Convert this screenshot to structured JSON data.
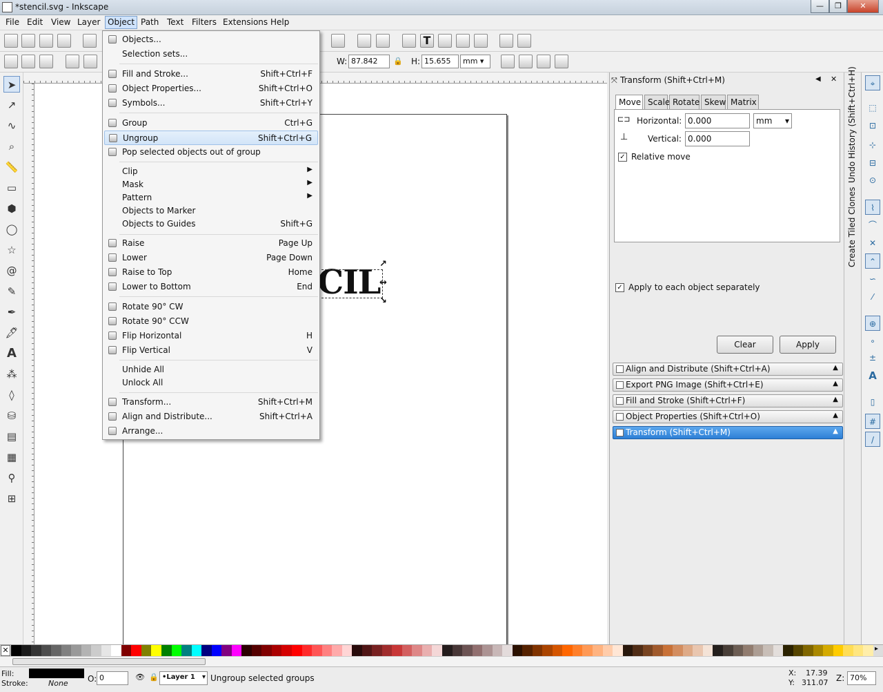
{
  "window": {
    "title": "*stencil.svg - Inkscape"
  },
  "menubar": [
    "File",
    "Edit",
    "View",
    "Layer",
    "Object",
    "Path",
    "Text",
    "Filters",
    "Extensions",
    "Help"
  ],
  "toolbar": {
    "w_label": "W:",
    "w_value": "87.842",
    "h_label": "H:",
    "h_value": "15.655",
    "unit": "mm"
  },
  "canvas": {
    "text": "CIL"
  },
  "object_menu": {
    "items": [
      {
        "label": "Objects...",
        "shortcut": ""
      },
      {
        "label": "Selection sets...",
        "shortcut": ""
      },
      {
        "label": "Fill and Stroke...",
        "shortcut": "Shift+Ctrl+F"
      },
      {
        "label": "Object Properties...",
        "shortcut": "Shift+Ctrl+O"
      },
      {
        "label": "Symbols...",
        "shortcut": "Shift+Ctrl+Y"
      },
      {
        "label": "Group",
        "shortcut": "Ctrl+G"
      },
      {
        "label": "Ungroup",
        "shortcut": "Shift+Ctrl+G"
      },
      {
        "label": "Pop selected objects out of group",
        "shortcut": ""
      },
      {
        "label": "Clip",
        "shortcut": ""
      },
      {
        "label": "Mask",
        "shortcut": ""
      },
      {
        "label": "Pattern",
        "shortcut": ""
      },
      {
        "label": "Objects to Marker",
        "shortcut": ""
      },
      {
        "label": "Objects to Guides",
        "shortcut": "Shift+G"
      },
      {
        "label": "Raise",
        "shortcut": "Page Up"
      },
      {
        "label": "Lower",
        "shortcut": "Page Down"
      },
      {
        "label": "Raise to Top",
        "shortcut": "Home"
      },
      {
        "label": "Lower to Bottom",
        "shortcut": "End"
      },
      {
        "label": "Rotate 90° CW",
        "shortcut": ""
      },
      {
        "label": "Rotate 90° CCW",
        "shortcut": ""
      },
      {
        "label": "Flip Horizontal",
        "shortcut": "H"
      },
      {
        "label": "Flip Vertical",
        "shortcut": "V"
      },
      {
        "label": "Unhide All",
        "shortcut": ""
      },
      {
        "label": "Unlock All",
        "shortcut": ""
      },
      {
        "label": "Transform...",
        "shortcut": "Shift+Ctrl+M"
      },
      {
        "label": "Align and Distribute...",
        "shortcut": "Shift+Ctrl+A"
      },
      {
        "label": "Arrange...",
        "shortcut": ""
      }
    ]
  },
  "transform": {
    "title": "Transform (Shift+Ctrl+M)",
    "tabs": [
      "Move",
      "Scale",
      "Rotate",
      "Skew",
      "Matrix"
    ],
    "horizontal_label": "Horizontal:",
    "horizontal_value": "0.000",
    "unit": "mm",
    "vertical_label": "Vertical:",
    "vertical_value": "0.000",
    "relative_move": "Relative move",
    "apply_each": "Apply to each object separately",
    "clear": "Clear",
    "apply": "Apply"
  },
  "dock": [
    "Align and Distribute (Shift+Ctrl+A)",
    "Export PNG Image (Shift+Ctrl+E)",
    "Fill and Stroke (Shift+Ctrl+F)",
    "Object Properties (Shift+Ctrl+O)",
    "Transform (Shift+Ctrl+M)"
  ],
  "vtabs": {
    "undo": "Undo History (Shift+Ctrl+H)",
    "tiled": "Create Tiled Clones"
  },
  "status": {
    "fill_label": "Fill:",
    "stroke_label": "Stroke:",
    "stroke_value": "None",
    "opacity_label": "O:",
    "opacity_value": "0",
    "layer": "•Layer 1",
    "message": "Ungroup selected groups",
    "x_label": "X:",
    "x_value": "17.39",
    "y_label": "Y:",
    "y_value": "311.07",
    "zoom_label": "Z:",
    "zoom_value": "70%"
  },
  "palette": [
    "#000000",
    "#1a1a1a",
    "#333333",
    "#4d4d4d",
    "#666666",
    "#808080",
    "#999999",
    "#b3b3b3",
    "#cccccc",
    "#e6e6e6",
    "#ffffff",
    "#800000",
    "#ff0000",
    "#808000",
    "#ffff00",
    "#008000",
    "#00ff00",
    "#008080",
    "#00ffff",
    "#000080",
    "#0000ff",
    "#800080",
    "#ff00ff",
    "#2b0000",
    "#550000",
    "#800000",
    "#aa0000",
    "#d40000",
    "#ff0000",
    "#ff2a2a",
    "#ff5555",
    "#ff8080",
    "#ffaaaa",
    "#ffd5d5",
    "#280b0b",
    "#501616",
    "#782121",
    "#a02c2c",
    "#c83737",
    "#d35f5f",
    "#de8787",
    "#e9afaf",
    "#f4d7d7",
    "#241c1c",
    "#483737",
    "#6c5353",
    "#916f6f",
    "#ac9393",
    "#c8b7b7",
    "#e3dbdb",
    "#2b1100",
    "#552200",
    "#803300",
    "#aa4400",
    "#d45500",
    "#ff6600",
    "#ff7f2a",
    "#ff9955",
    "#ffb380",
    "#ffccaa",
    "#ffe6d5",
    "#28170b",
    "#502d16",
    "#784421",
    "#a05a2c",
    "#c87137",
    "#d38d5f",
    "#deaa87",
    "#e9c6af",
    "#f4e3d7",
    "#241f1c",
    "#483e37",
    "#6c5d53",
    "#917c6f",
    "#ac9d93",
    "#c8beb7",
    "#e3dedb",
    "#2b2200",
    "#554400",
    "#806600",
    "#aa8800",
    "#d4aa00",
    "#ffcc00",
    "#ffdd55",
    "#ffe680",
    "#ffeeaa"
  ]
}
